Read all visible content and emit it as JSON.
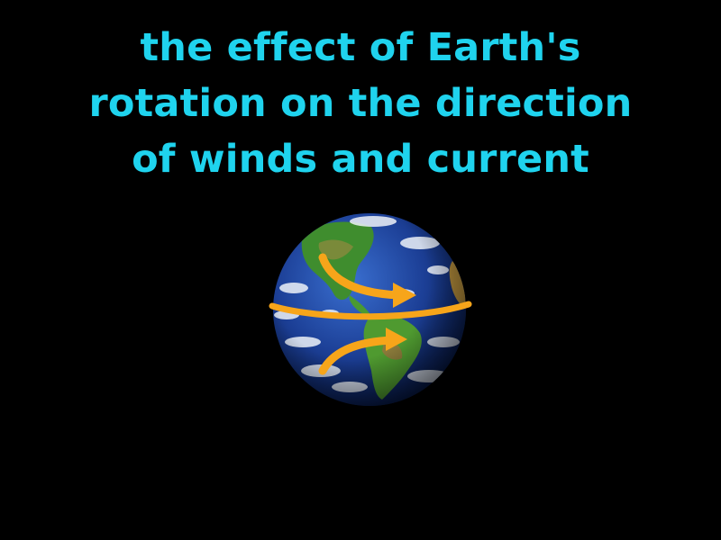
{
  "definition": {
    "lines": [
      "the effect of Earth's",
      "rotation on the direction",
      "of winds and current"
    ]
  },
  "illustration": {
    "subject": "earth-globe",
    "arrow_icons": [
      "curved-arrow-right-icon",
      "curved-arrow-right-icon"
    ],
    "equator_icon": "equator-arc-icon"
  },
  "colors": {
    "background": "#000000",
    "caption": "#1fd3ee",
    "arrow": "#f7a51a",
    "ocean": "#1a3f95",
    "land": "#3f8d2e",
    "cloud": "#eef2f8"
  }
}
